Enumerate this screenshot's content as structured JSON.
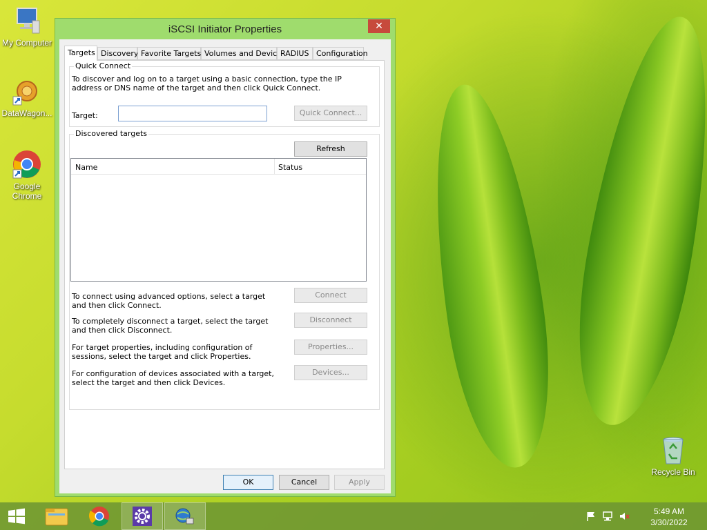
{
  "desktop": {
    "icons": [
      {
        "label": "My Computer",
        "icon": "computer-icon"
      },
      {
        "label": "DataWagon...",
        "icon": "datawagon-icon"
      },
      {
        "label": "Google Chrome",
        "icon": "chrome-icon"
      },
      {
        "label": "Recycle Bin",
        "icon": "recycle-bin-icon"
      }
    ]
  },
  "window": {
    "title": "iSCSI Initiator Properties",
    "close_glyph": "✕",
    "tabs": [
      {
        "label": "Targets",
        "active": true
      },
      {
        "label": "Discovery"
      },
      {
        "label": "Favorite Targets"
      },
      {
        "label": "Volumes and Devices"
      },
      {
        "label": "RADIUS"
      },
      {
        "label": "Configuration"
      }
    ],
    "quick_connect": {
      "group_label": "Quick Connect",
      "description": "To discover and log on to a target using a basic connection, type the IP address or DNS name of the target and then click Quick Connect.",
      "target_label": "Target:",
      "target_value": "",
      "button": "Quick Connect..."
    },
    "discovered": {
      "group_label": "Discovered targets",
      "refresh_button": "Refresh",
      "columns": [
        "Name",
        "Status"
      ],
      "rows": []
    },
    "actions": [
      {
        "description": "To connect using advanced options, select a target and then click Connect.",
        "button": "Connect"
      },
      {
        "description": "To completely disconnect a target, select the target and then click Disconnect.",
        "button": "Disconnect"
      },
      {
        "description": "For target properties, including configuration of sessions, select the target and click Properties.",
        "button": "Properties..."
      },
      {
        "description": "For configuration of devices associated with a target, select the target and then click Devices.",
        "button": "Devices..."
      }
    ],
    "footer": {
      "ok": "OK",
      "cancel": "Cancel",
      "apply": "Apply"
    }
  },
  "taskbar": {
    "start_icon": "windows-start-icon",
    "items": [
      "file-explorer-icon",
      "chrome-icon",
      "settings-gear-icon",
      "iscsi-initiator-icon"
    ],
    "tray_icons": [
      "action-center-flag-icon",
      "network-icon",
      "volume-muted-icon"
    ],
    "time": "5:49 AM",
    "date": "3/30/2022"
  },
  "colors": {
    "window_frame": "#9fdc6d",
    "close_button": "#c74a3c",
    "taskbar": "#6e9632"
  }
}
